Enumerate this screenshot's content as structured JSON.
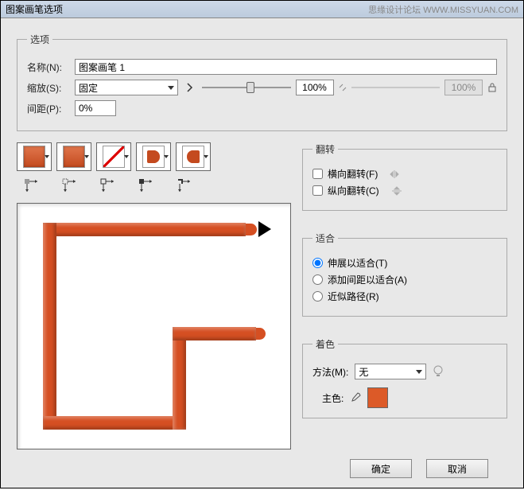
{
  "title": "图案画笔选项",
  "watermark": "思缘设计论坛 WWW.MISSYUAN.COM",
  "options": {
    "legend": "选项",
    "name_label": "名称(N):",
    "name_value": "图案画笔 1",
    "scale_label": "缩放(S):",
    "scale_mode": "固定",
    "scale_value": "100%",
    "scale_value_disabled": "100%",
    "spacing_label": "间距(P):",
    "spacing_value": "0%"
  },
  "flip": {
    "legend": "翻转",
    "horizontal": "横向翻转(F)",
    "vertical": "纵向翻转(C)"
  },
  "fit": {
    "legend": "适合",
    "stretch": "伸展以适合(T)",
    "addspace": "添加间距以适合(A)",
    "approx": "近似路径(R)"
  },
  "colorize": {
    "legend": "着色",
    "method_label": "方法(M):",
    "method_value": "无",
    "key_label": "主色:"
  },
  "buttons": {
    "ok": "确定",
    "cancel": "取消"
  },
  "swatch_color": "#dc5a28"
}
